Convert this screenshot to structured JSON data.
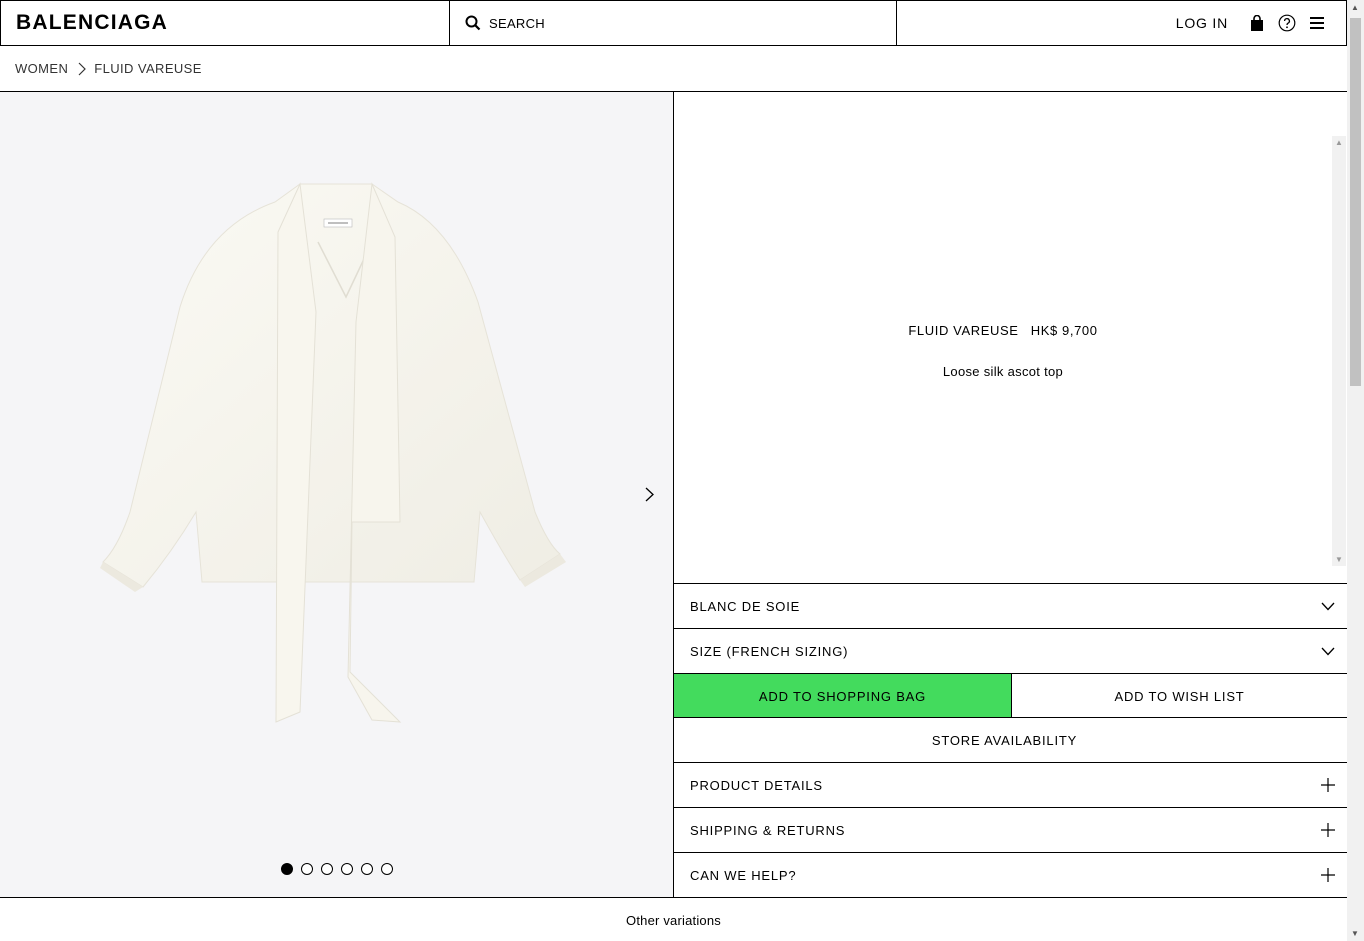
{
  "header": {
    "logo": "BALENCIAGA",
    "search_placeholder": "SEARCH",
    "login": "LOG IN",
    "icons": [
      "search-icon",
      "shopping-bag-icon",
      "help-icon",
      "menu-icon"
    ]
  },
  "breadcrumb": [
    "WOMEN",
    "FLUID VAREUSE"
  ],
  "gallery": {
    "dot_count": 6,
    "active_index": 0
  },
  "product": {
    "name": "FLUID VAREUSE",
    "price": "HK$ 9,700",
    "description": "Loose silk ascot top"
  },
  "options": {
    "color": "BLANC DE SOIE",
    "size": "SIZE (FRENCH SIZING)"
  },
  "actions": {
    "add_to_bag": "ADD TO SHOPPING BAG",
    "add_to_wishlist": "ADD TO WISH LIST",
    "store_availability": "STORE AVAILABILITY"
  },
  "accordions": [
    "PRODUCT DETAILS",
    "SHIPPING & RETURNS",
    "CAN WE HELP?"
  ],
  "footer": {
    "other_variations": "Other variations"
  },
  "colors": {
    "accent_green": "#43db5d",
    "gallery_bg": "#f5f5f7"
  }
}
